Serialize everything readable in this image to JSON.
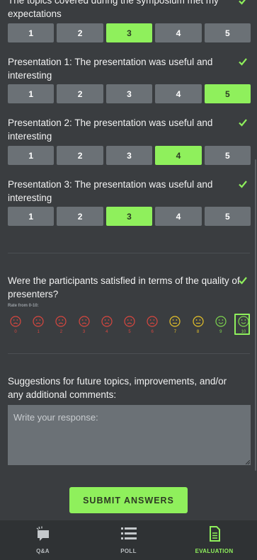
{
  "colors": {
    "accent": "#8ff05c",
    "button_bg": "#6b7176",
    "background": "#3a3d40",
    "nav_bg": "#2f3234",
    "red": "#d9473f",
    "yellow": "#e6c229",
    "green": "#7ed64e"
  },
  "questions": [
    {
      "text": "The topics covered during the symposium met my expectations",
      "options": [
        "1",
        "2",
        "3",
        "4",
        "5"
      ],
      "selected": "3",
      "answered": true
    },
    {
      "text": "Presentation 1: The presentation was useful and interesting",
      "options": [
        "1",
        "2",
        "3",
        "4",
        "5"
      ],
      "selected": "5",
      "answered": true
    },
    {
      "text": "Presentation 2: The presentation was useful and interesting",
      "options": [
        "1",
        "2",
        "3",
        "4",
        "5"
      ],
      "selected": "4",
      "answered": true
    },
    {
      "text": "Presentation 3: The presentation was useful and interesting",
      "options": [
        "1",
        "2",
        "3",
        "4",
        "5"
      ],
      "selected": "3",
      "answered": true
    }
  ],
  "rating": {
    "text": "Were the participants satisfied in terms of the quality of presenters?",
    "hint": "Rate from 0-10:",
    "options": [
      "0",
      "1",
      "2",
      "3",
      "4",
      "5",
      "6",
      "7",
      "8",
      "9",
      "10"
    ],
    "selected": "10",
    "answered": true
  },
  "suggestions": {
    "text": "Suggestions for future topics, improvements, and/or any additional comments:",
    "placeholder": "Write your response:",
    "value": ""
  },
  "submit_label": "SUBMIT ANSWERS",
  "nav": {
    "tabs": [
      {
        "label": "Q&A",
        "icon": "qa-chat-icon",
        "active": false
      },
      {
        "label": "POLL",
        "icon": "poll-list-icon",
        "active": false
      },
      {
        "label": "EVALUATION",
        "icon": "evaluation-document-icon",
        "active": true
      }
    ]
  }
}
